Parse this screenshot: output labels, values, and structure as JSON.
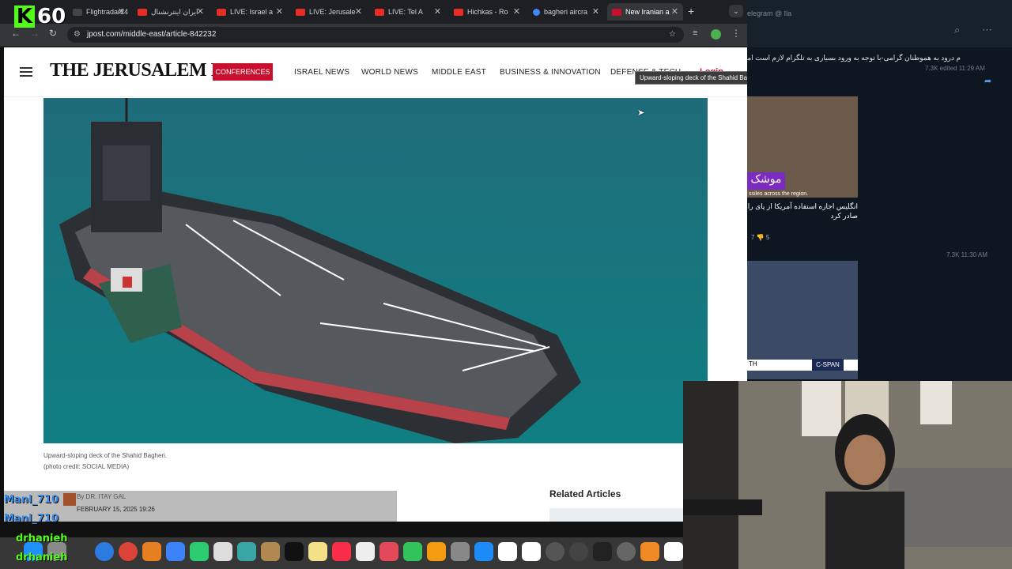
{
  "overlay": {
    "kick_logo": "K",
    "viewer_count": "60"
  },
  "browser": {
    "tabs": [
      {
        "label": "Flightradar24",
        "color": "#444"
      },
      {
        "label": "ایران اینترنشنال",
        "color": "#e52d27"
      },
      {
        "label": "LIVE: Israel a",
        "color": "#e52d27"
      },
      {
        "label": "LIVE: Jerusale",
        "color": "#e52d27"
      },
      {
        "label": "LIVE: Tel A",
        "color": "#e52d27"
      },
      {
        "label": "Hichkas - Ro",
        "color": "#e52d27"
      },
      {
        "label": "bagheri aircra",
        "color": "#4285f4"
      },
      {
        "label": "New Iranian a",
        "color": "#c8102e"
      }
    ],
    "url": "jpost.com/middle-east/article-842232"
  },
  "site": {
    "logo": "THE JERUSALEM POST",
    "conferences": "CONFERENCES",
    "nav": [
      "ISRAEL NEWS",
      "WORLD NEWS",
      "MIDDLE EAST",
      "BUSINESS & INNOVATION",
      "DEFENSE & TECH"
    ],
    "login": "Login"
  },
  "article": {
    "tooltip": "Upward-sloping deck of the Shahid Bagheri.",
    "caption_line1": "Upward-sloping deck of the Shahid Bagheri.",
    "caption_line2": "(photo credit: SOCIAL MEDIA)",
    "author": "By DR. ITAY GAL",
    "date": "FEBRUARY 15, 2025 19:26",
    "related": "Related Articles"
  },
  "telegram": {
    "header": "elegram @ Ila",
    "message": "م درود به هموطنان گرامی-با توجه به ورود بسیاری به تلگرام لازم است امنیت مجا",
    "meta1": "7.3K edited 11:29 AM",
    "thumb_text": "موشک",
    "thumb_sub": "ssiles across the region.",
    "alert": "انگلیس اجازه استفاده آمریکا از پای را صادر کرد",
    "reactions": "7 👎 5",
    "meta2": "7.3K 11:30 AM",
    "cspan": "C-SPAN",
    "cspan_left": "TH"
  },
  "chat": [
    {
      "user": "Manl_710",
      "color": "#3a8ee6"
    },
    {
      "user": "Manl_710",
      "color": "#3a8ee6"
    },
    {
      "user": "drhanieh",
      "color": "#53fc18"
    },
    {
      "user": "drhanieh",
      "color": "#53fc18"
    }
  ]
}
